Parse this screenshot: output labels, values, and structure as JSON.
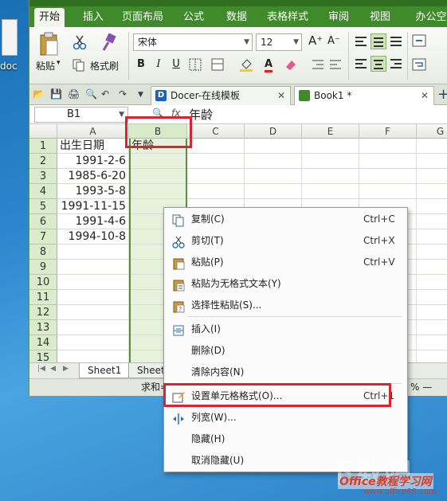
{
  "desktop": {
    "file_label": "doc"
  },
  "menubar": {
    "tabs": [
      "开始",
      "插入",
      "页面布局",
      "公式",
      "数据",
      "表格样式",
      "审阅",
      "视图",
      "办公空"
    ],
    "active": "开始"
  },
  "ribbon": {
    "paste": "粘贴",
    "cut_icon": "scissors-icon",
    "format_painter": "格式刷",
    "font_name": "宋体",
    "font_size": "12",
    "grow_font": "A⁺",
    "shrink_font": "A⁻",
    "bold": "B",
    "italic": "I",
    "underline": "U"
  },
  "doc_tabs": [
    {
      "label": "Docer-在线模板",
      "close": "✕"
    },
    {
      "label": "Book1 *",
      "close": "✕"
    }
  ],
  "new_tab": "+",
  "formula_bar": {
    "cell_ref": "B1",
    "fx": "fx",
    "value": "年龄"
  },
  "columns": [
    "A",
    "B",
    "C",
    "D",
    "E",
    "F",
    "G"
  ],
  "rows": [
    {
      "num": "1",
      "a": "出生日期",
      "b": "年龄"
    },
    {
      "num": "2",
      "a": "1991-2-6",
      "b": ""
    },
    {
      "num": "3",
      "a": "1985-6-20",
      "b": ""
    },
    {
      "num": "4",
      "a": "1993-5-8",
      "b": ""
    },
    {
      "num": "5",
      "a": "1991-11-15",
      "b": ""
    },
    {
      "num": "6",
      "a": "1991-4-6",
      "b": ""
    },
    {
      "num": "7",
      "a": "1994-10-8",
      "b": ""
    },
    {
      "num": "8",
      "a": "",
      "b": ""
    },
    {
      "num": "9",
      "a": "",
      "b": ""
    },
    {
      "num": "10",
      "a": "",
      "b": ""
    },
    {
      "num": "11",
      "a": "",
      "b": ""
    },
    {
      "num": "12",
      "a": "",
      "b": ""
    },
    {
      "num": "13",
      "a": "",
      "b": ""
    },
    {
      "num": "14",
      "a": "",
      "b": ""
    },
    {
      "num": "15",
      "a": "",
      "b": ""
    }
  ],
  "sheets": [
    "Sheet1",
    "Sheet2"
  ],
  "status": {
    "sum": "求和=",
    "zoom_minus": "% —"
  },
  "context_menu": [
    {
      "label": "复制(C)",
      "shortcut": "Ctrl+C",
      "icon": "copy-icon"
    },
    {
      "label": "剪切(T)",
      "shortcut": "Ctrl+X",
      "icon": "scissors-icon"
    },
    {
      "label": "粘贴(P)",
      "shortcut": "Ctrl+V",
      "icon": "paste-icon"
    },
    {
      "label": "粘贴为无格式文本(Y)",
      "shortcut": "",
      "icon": "paste-text-icon"
    },
    {
      "label": "选择性粘贴(S)...",
      "shortcut": "",
      "icon": "paste-special-icon"
    },
    {
      "label": "插入(I)",
      "shortcut": "",
      "icon": "insert-icon"
    },
    {
      "label": "删除(D)",
      "shortcut": "",
      "icon": ""
    },
    {
      "label": "清除内容(N)",
      "shortcut": "",
      "icon": ""
    },
    {
      "label": "设置单元格格式(O)...",
      "shortcut": "Ctrl+1",
      "icon": "format-cells-icon"
    },
    {
      "label": "列宽(W)...",
      "shortcut": "",
      "icon": "column-width-icon"
    },
    {
      "label": "隐藏(H)",
      "shortcut": "",
      "icon": ""
    },
    {
      "label": "取消隐藏(U)",
      "shortcut": "",
      "icon": ""
    }
  ],
  "watermark": {
    "big": "下载吧",
    "site": "Office教程学习网",
    "url": "www.office68.com"
  }
}
